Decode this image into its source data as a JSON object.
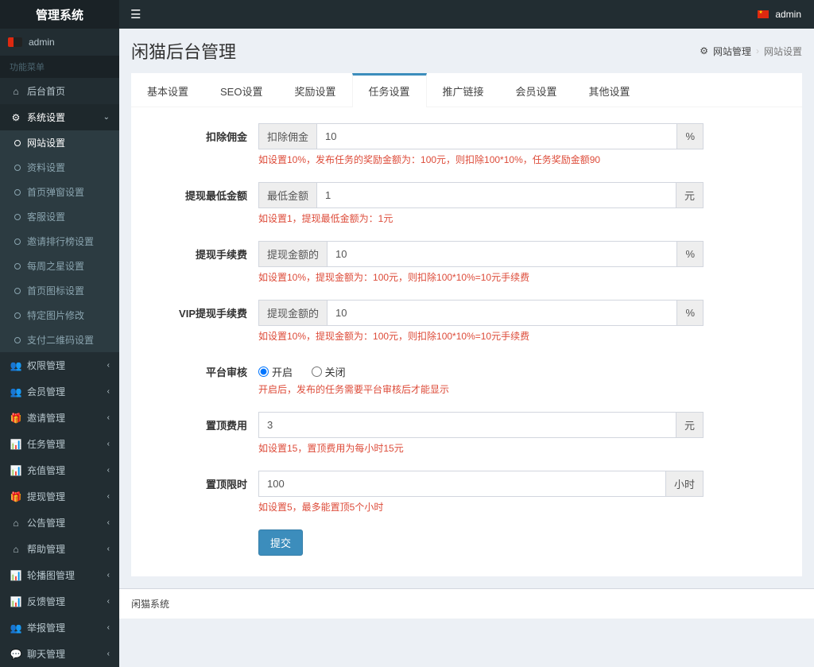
{
  "brand": "管理系统",
  "topbar": {
    "user": "admin"
  },
  "sidebar": {
    "user": "admin",
    "header": "功能菜单",
    "items": [
      {
        "label": "后台首页",
        "icon": "⌂"
      },
      {
        "label": "系统设置",
        "icon": "⚙",
        "expandable": true,
        "open": true
      }
    ],
    "sysSub": [
      {
        "label": "网站设置",
        "active": true
      },
      {
        "label": "资料设置"
      },
      {
        "label": "首页弹窗设置"
      },
      {
        "label": "客服设置"
      },
      {
        "label": "邀请排行榜设置"
      },
      {
        "label": "每周之星设置"
      },
      {
        "label": "首页图标设置"
      },
      {
        "label": "特定图片修改"
      },
      {
        "label": "支付二维码设置"
      }
    ],
    "rest": [
      {
        "label": "权限管理",
        "icon": "👥"
      },
      {
        "label": "会员管理",
        "icon": "👥"
      },
      {
        "label": "邀请管理",
        "icon": "🎁"
      },
      {
        "label": "任务管理",
        "icon": "📊"
      },
      {
        "label": "充值管理",
        "icon": "📊"
      },
      {
        "label": "提现管理",
        "icon": "🎁"
      },
      {
        "label": "公告管理",
        "icon": "⌂"
      },
      {
        "label": "帮助管理",
        "icon": "⌂"
      },
      {
        "label": "轮播图管理",
        "icon": "📊"
      },
      {
        "label": "反馈管理",
        "icon": "📊"
      },
      {
        "label": "举报管理",
        "icon": "👥"
      },
      {
        "label": "聊天管理",
        "icon": "💬"
      }
    ]
  },
  "page": {
    "title": "闲猫后台管理",
    "breadcrumb": {
      "icon": "⚙",
      "parent": "网站管理",
      "current": "网站设置"
    }
  },
  "tabs": [
    {
      "label": "基本设置"
    },
    {
      "label": "SEO设置"
    },
    {
      "label": "奖励设置"
    },
    {
      "label": "任务设置",
      "active": true
    },
    {
      "label": "推广链接"
    },
    {
      "label": "会员设置"
    },
    {
      "label": "其他设置"
    }
  ],
  "form": {
    "commission": {
      "label": "扣除佣金",
      "prefix": "扣除佣金",
      "value": "10",
      "suffix": "%",
      "hint": "如设置10%，发布任务的奖励金额为：100元，则扣除100*10%，任务奖励金额90"
    },
    "minWithdraw": {
      "label": "提现最低金额",
      "prefix": "最低金额",
      "value": "1",
      "suffix": "元",
      "hint": "如设置1，提现最低金额为：1元"
    },
    "withdrawFee": {
      "label": "提现手续费",
      "prefix": "提现金额的",
      "value": "10",
      "suffix": "%",
      "hint": "如设置10%，提现金额为：100元，则扣除100*10%=10元手续费"
    },
    "vipWithdrawFee": {
      "label": "VIP提现手续费",
      "prefix": "提现金额的",
      "value": "10",
      "suffix": "%",
      "hint": "如设置10%，提现金额为：100元，则扣除100*10%=10元手续费"
    },
    "audit": {
      "label": "平台审核",
      "options": [
        "开启",
        "关闭"
      ],
      "value": "开启",
      "hint": "开启后，发布的任务需要平台审核后才能显示"
    },
    "topFee": {
      "label": "置顶费用",
      "value": "3",
      "suffix": "元",
      "hint": "如设置15，置顶费用为每小时15元"
    },
    "topLimit": {
      "label": "置顶限时",
      "value": "100",
      "suffix": "小时",
      "hint": "如设置5，最多能置顶5个小时"
    },
    "submit": "提交"
  },
  "footer": "闲猫系统"
}
